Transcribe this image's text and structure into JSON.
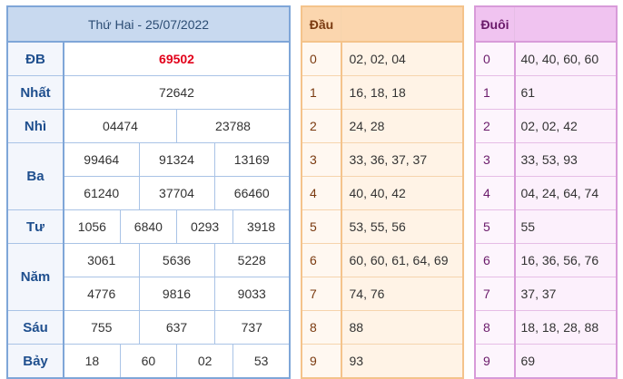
{
  "results": {
    "title": "Thứ Hai - 25/07/2022",
    "db": {
      "label": "ĐB",
      "value": "69502"
    },
    "nhat": {
      "label": "Nhất",
      "value": "72642"
    },
    "nhi": {
      "label": "Nhì",
      "values": [
        "04474",
        "23788"
      ]
    },
    "ba": {
      "label": "Ba",
      "values": [
        "99464",
        "91324",
        "13169",
        "61240",
        "37704",
        "66460"
      ]
    },
    "tu": {
      "label": "Tư",
      "values": [
        "1056",
        "6840",
        "0293",
        "3918"
      ]
    },
    "nam": {
      "label": "Năm",
      "values": [
        "3061",
        "5636",
        "5228",
        "4776",
        "9816",
        "9033"
      ]
    },
    "sau": {
      "label": "Sáu",
      "values": [
        "755",
        "637",
        "737"
      ]
    },
    "bay": {
      "label": "Bảy",
      "values": [
        "18",
        "60",
        "02",
        "53"
      ]
    }
  },
  "dau": {
    "header": "Đầu",
    "rows": [
      {
        "key": "0",
        "value": "02, 02, 04"
      },
      {
        "key": "1",
        "value": "16, 18, 18"
      },
      {
        "key": "2",
        "value": "24, 28"
      },
      {
        "key": "3",
        "value": "33, 36, 37, 37"
      },
      {
        "key": "4",
        "value": "40, 40, 42"
      },
      {
        "key": "5",
        "value": "53, 55, 56"
      },
      {
        "key": "6",
        "value": "60, 60, 61, 64, 69"
      },
      {
        "key": "7",
        "value": "74, 76"
      },
      {
        "key": "8",
        "value": "88"
      },
      {
        "key": "9",
        "value": "93"
      }
    ]
  },
  "duoi": {
    "header": "Đuôi",
    "rows": [
      {
        "key": "0",
        "value": "40, 40, 60, 60"
      },
      {
        "key": "1",
        "value": "61"
      },
      {
        "key": "2",
        "value": "02, 02, 42"
      },
      {
        "key": "3",
        "value": "33, 53, 93"
      },
      {
        "key": "4",
        "value": "04, 24, 64, 74"
      },
      {
        "key": "5",
        "value": "55"
      },
      {
        "key": "6",
        "value": "16, 36, 56, 76"
      },
      {
        "key": "7",
        "value": "37, 37"
      },
      {
        "key": "8",
        "value": "18, 18, 28, 88"
      },
      {
        "key": "9",
        "value": "69"
      }
    ]
  },
  "colors": {
    "special_prize": "#e2001a",
    "results_border": "#7fa6d8",
    "dau_border": "#f4c38b",
    "duoi_border": "#d89bd9"
  }
}
